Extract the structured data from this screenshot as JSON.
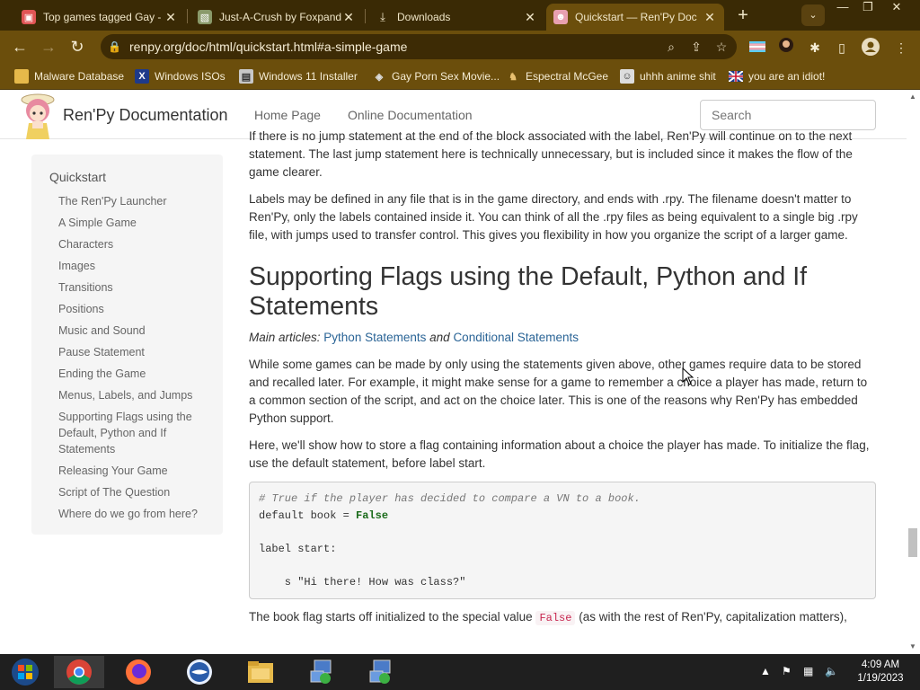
{
  "browser": {
    "tabs": [
      {
        "title": "Top games tagged Gay - it",
        "icon": "itchio-icon",
        "color": "#e05555",
        "active": false
      },
      {
        "title": "Just-A-Crush by Foxpanda",
        "icon": "image-tab-icon",
        "color": "#8a9a6a",
        "active": false
      },
      {
        "title": "Downloads",
        "icon": "download-icon",
        "color": "#ffffff",
        "active": false
      },
      {
        "title": "Quickstart — Ren'Py Doc",
        "icon": "renpy-icon",
        "color": "#e8a0b0",
        "active": true
      }
    ],
    "new_tab": "+",
    "tab_search": "⌄",
    "window_controls": {
      "minimize": "—",
      "restore": "❐",
      "close": "✕"
    },
    "url": "renpy.org/doc/html/quickstart.html#a-simple-game",
    "bookmarks": [
      {
        "label": "Malware Database",
        "icon": "folder-icon"
      },
      {
        "label": "Windows ISOs",
        "icon": "x-icon"
      },
      {
        "label": "Windows 11 Installer",
        "icon": "installer-icon"
      },
      {
        "label": "Gay Porn Sex Movie...",
        "icon": "site-icon"
      },
      {
        "label": "Espectral McGee",
        "icon": "avatar-icon"
      },
      {
        "label": "uhhh anime shit",
        "icon": "anime-icon"
      },
      {
        "label": "you are an idiot!",
        "icon": "flag-icon"
      }
    ]
  },
  "doc": {
    "brand": "Ren'Py Documentation",
    "nav": [
      "Home Page",
      "Online Documentation"
    ],
    "search_placeholder": "Search",
    "sidebar_title": "Quickstart",
    "sidebar_items": [
      "The Ren'Py Launcher",
      "A Simple Game",
      "Characters",
      "Images",
      "Transitions",
      "Positions",
      "Music and Sound",
      "Pause Statement",
      "Ending the Game",
      "Menus, Labels, and Jumps",
      "Supporting Flags using the Default, Python and If Statements",
      "Releasing Your Game",
      "Script of The Question",
      "Where do we go from here?"
    ],
    "para_partial": "If there is no jump statement at the end of the block associated with the label, Ren'Py will continue on to the next statement. The last jump statement here is technically unnecessary, but is included since it makes the flow of the game clearer.",
    "para_labels": "Labels may be defined in any file that is in the game directory, and ends with .rpy. The filename doesn't matter to Ren'Py, only the labels contained inside it. You can think of all the .rpy files as being equivalent to a single big .rpy file, with jumps used to transfer control. This gives you flexibility in how you organize the script of a larger game.",
    "heading": "Supporting Flags using the Default, Python and If Statements",
    "main_articles_label": "Main articles:",
    "main_article_1": "Python Statements",
    "main_articles_and": "and",
    "main_article_2": "Conditional Statements",
    "para_flags": "While some games can be made by only using the statements given above, other games require data to be stored and recalled later. For example, it might make sense for a game to remember a choice a player has made, return to a common section of the script, and act on the choice later. This is one of the reasons why Ren'Py has embedded Python support.",
    "para_show": "Here, we'll show how to store a flag containing information about a choice the player has made. To initialize the flag, use the default statement, before label start.",
    "code": {
      "comment": "# True if the player has decided to compare a VN to a book.",
      "line2_a": "default book = ",
      "line2_kw": "False",
      "line4": "label start:",
      "line6": "    s \"Hi there! How was class?\""
    },
    "para_last_a": "The book flag starts off initialized to the special value ",
    "para_last_code": "False",
    "para_last_b": " (as with the rest of Ren'Py, capitalization matters),"
  },
  "taskbar": {
    "apps": [
      "start-orb-icon",
      "chrome-icon",
      "firefox-icon",
      "windows-logo-icon",
      "file-explorer-icon",
      "network-app-icon",
      "network-app-icon-2"
    ],
    "time": "4:09 AM",
    "date": "1/19/2023"
  },
  "colors": {
    "chrome_dark": "#3a2a05",
    "chrome_toolbar": "#6b4e0c",
    "link": "#2a6496"
  }
}
